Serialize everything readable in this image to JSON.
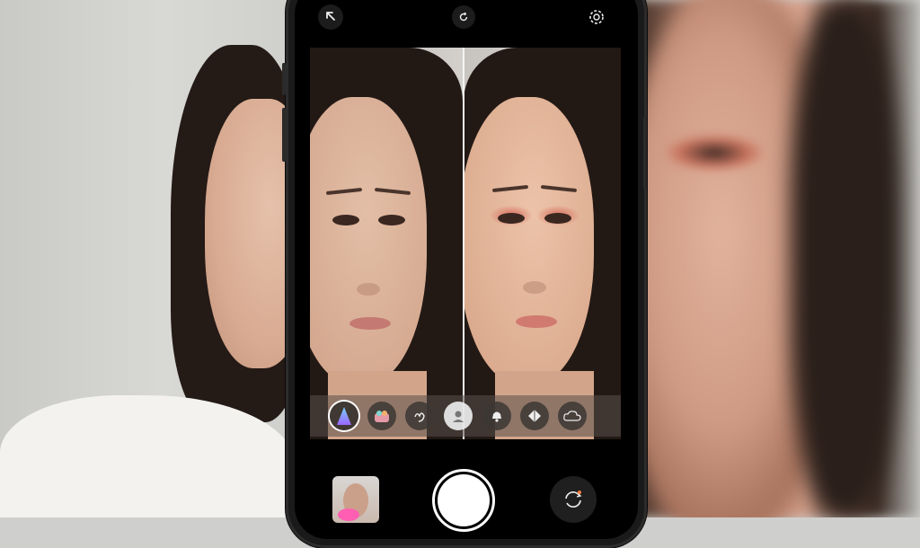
{
  "app": {
    "top_bar": {
      "back_icon": "back-arrow-icon",
      "center_icon": "refresh-icon",
      "right_icon": "settings-gear-icon"
    },
    "viewfinder": {
      "mode": "before-after-split",
      "left_label": "",
      "right_label": ""
    },
    "effects_tray": {
      "items": [
        {
          "name": "gradient-filter",
          "selected": true
        },
        {
          "name": "palette",
          "selected": false
        },
        {
          "name": "hand-gesture",
          "selected": false
        },
        {
          "name": "portrait",
          "selected": false
        },
        {
          "name": "bell",
          "selected": false
        },
        {
          "name": "diamond",
          "selected": false
        },
        {
          "name": "cloud",
          "selected": false
        }
      ]
    },
    "bottom_controls": {
      "gallery_icon": "gallery-thumbnail",
      "shutter_icon": "shutter-button",
      "flip_icon": "camera-flip-icon"
    },
    "colors": {
      "accent": "#ffffff",
      "makeup_shadow": "#d8695a",
      "tray_bg": "#5a504b"
    }
  }
}
